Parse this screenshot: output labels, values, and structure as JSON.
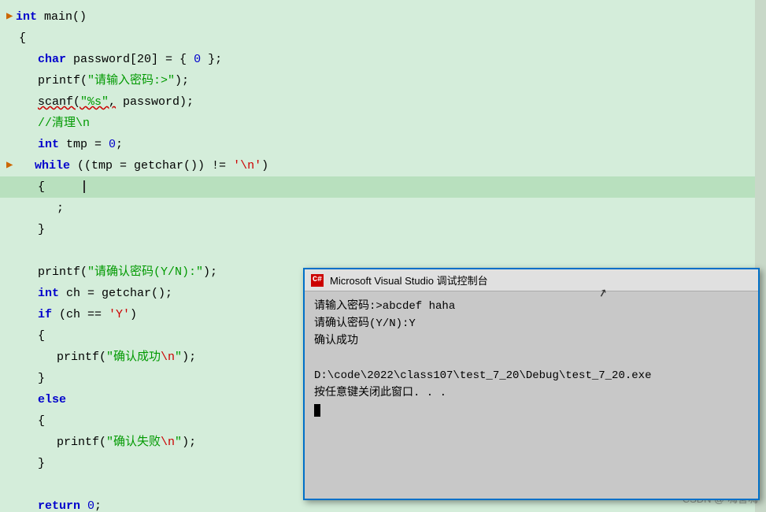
{
  "editor": {
    "background": "#d4edda",
    "lines": [
      {
        "id": 1,
        "indicator": "▶",
        "num": "",
        "content": "int_main_header",
        "raw": "int main()"
      },
      {
        "id": 2,
        "indicator": "",
        "num": "",
        "content": "brace_open",
        "raw": "{"
      },
      {
        "id": 3,
        "indicator": "",
        "num": "",
        "content": "char_password",
        "raw": "    char password[20] = { 0 };"
      },
      {
        "id": 4,
        "indicator": "",
        "num": "",
        "content": "printf_prompt",
        "raw": "    printf(\"请输入密码:>\");"
      },
      {
        "id": 5,
        "indicator": "",
        "num": "",
        "content": "scanf_line",
        "raw": "    scanf(\"%s\", password);"
      },
      {
        "id": 6,
        "indicator": "",
        "num": "",
        "content": "comment_clear",
        "raw": "    //清理\\n"
      },
      {
        "id": 7,
        "indicator": "",
        "num": "",
        "content": "int_tmp",
        "raw": "    int tmp = 0;"
      },
      {
        "id": 8,
        "indicator": "▶",
        "num": "",
        "content": "while_line",
        "raw": "    while ((tmp = getchar()) != '\\n')"
      },
      {
        "id": 9,
        "indicator": "",
        "num": "",
        "content": "brace_open2",
        "raw": "    {"
      },
      {
        "id": 10,
        "indicator": "",
        "num": "",
        "content": "cursor_line",
        "raw": "        "
      },
      {
        "id": 11,
        "indicator": "",
        "num": "",
        "content": "semicolon_line",
        "raw": "        ;"
      },
      {
        "id": 12,
        "indicator": "",
        "num": "",
        "content": "brace_close2",
        "raw": "    }"
      },
      {
        "id": 13,
        "indicator": "",
        "num": "",
        "content": "empty1",
        "raw": ""
      },
      {
        "id": 14,
        "indicator": "",
        "num": "",
        "content": "printf_confirm",
        "raw": "    printf(\"请确认密码(Y/N):\");"
      },
      {
        "id": 15,
        "indicator": "",
        "num": "",
        "content": "int_ch",
        "raw": "    int ch = getchar();"
      },
      {
        "id": 16,
        "indicator": "",
        "num": "",
        "content": "if_ch",
        "raw": "    if (ch == 'Y')"
      },
      {
        "id": 17,
        "indicator": "",
        "num": "",
        "content": "brace_open3",
        "raw": "    {"
      },
      {
        "id": 18,
        "indicator": "",
        "num": "",
        "content": "printf_success",
        "raw": "        printf(\"确认成功\\n\");"
      },
      {
        "id": 19,
        "indicator": "",
        "num": "",
        "content": "brace_close3",
        "raw": "    }"
      },
      {
        "id": 20,
        "indicator": "",
        "num": "",
        "content": "else_line",
        "raw": "    else"
      },
      {
        "id": 21,
        "indicator": "",
        "num": "",
        "content": "brace_open4",
        "raw": "    {"
      },
      {
        "id": 22,
        "indicator": "",
        "num": "",
        "content": "printf_fail",
        "raw": "        printf(\"确认失败\\n\");"
      },
      {
        "id": 23,
        "indicator": "",
        "num": "",
        "content": "brace_close4",
        "raw": "    }"
      },
      {
        "id": 24,
        "indicator": "",
        "num": "",
        "content": "empty2",
        "raw": ""
      },
      {
        "id": 25,
        "indicator": "",
        "num": "",
        "content": "return_line",
        "raw": "    return 0;"
      }
    ]
  },
  "console": {
    "title": "Microsoft Visual Studio 调试控制台",
    "icon_label": "C#",
    "lines": [
      "请输入密码:>abcdef haha",
      "请确认密码(Y/N):Y",
      "确认成功",
      "",
      "D:\\code\\2022\\class107\\test_7_20\\Debug\\test_7_20.exe",
      "按任意键关闭此窗口. . ."
    ]
  },
  "watermark": {
    "text": "CSDN @  嗨害嗨"
  }
}
